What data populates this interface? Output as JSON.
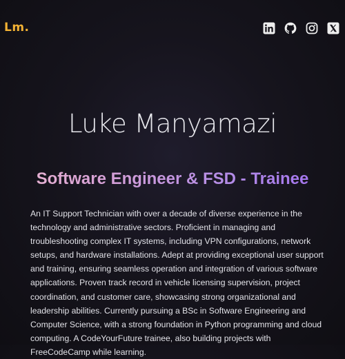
{
  "nav": {
    "logo_text": "Lm.",
    "socials": [
      {
        "icon": "linkedin-icon"
      },
      {
        "icon": "github-icon"
      },
      {
        "icon": "instagram-icon"
      },
      {
        "icon": "x-icon"
      }
    ]
  },
  "hero": {
    "name": "Luke Manyamazi",
    "role": "Software Engineer & FSD - Trainee",
    "bio": "An IT Support Technician with over a decade of diverse experience in the technology and administrative sectors. Proficient in managing and troubleshooting complex IT systems, including VPN configurations, network setups, and hardware installations. Adept at providing exceptional user support and training, ensuring seamless operation and integration of various software applications. Proven track record in vehicle licensing supervision, project coordination, and customer care, showcasing strong organizational and leadership abilities. Currently pursuing a BSc in Software Engineering and Computer Science, with a strong foundation in Python programming and cloud computing. A CodeYourFuture trainee, also building projects with FreeCodeCamp while learning."
  },
  "colors": {
    "logo": "#f3b234",
    "role_gradient_start": "#ecb8cf",
    "role_gradient_end": "#9d6cf0",
    "background": "#16141d"
  }
}
